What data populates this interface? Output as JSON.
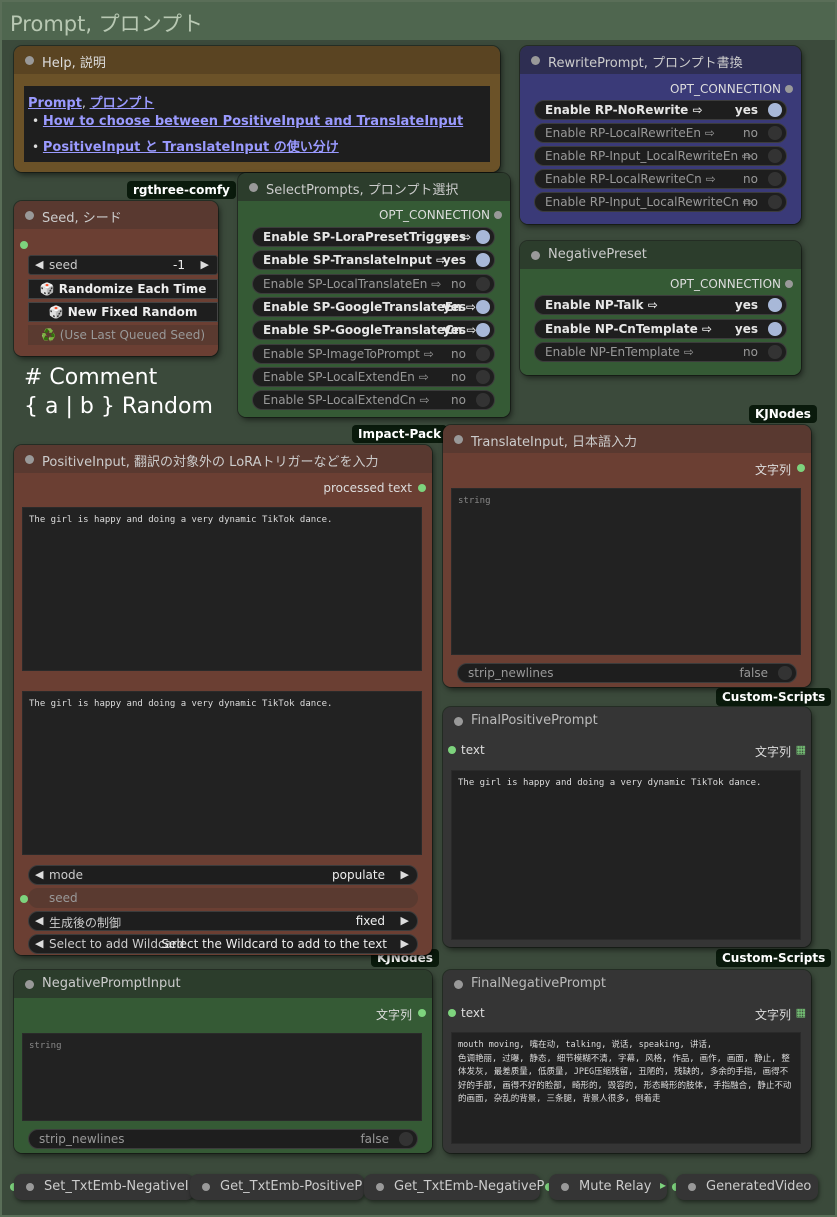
{
  "group": {
    "title": "Prompt, プロンプト"
  },
  "help": {
    "title": "Help, 説明",
    "link_main_a": "Prompt",
    "link_main_sep": ", ",
    "link_main_b": "プロンプト",
    "bullet": "•",
    "link1": "How to choose between PositiveInput and TranslateInput",
    "link2": "PositiveInput と TranslateInput の使い分け"
  },
  "rewrite": {
    "title": "RewritePrompt, プロンプト書換",
    "opt": "OPT_CONNECTION",
    "toggles": [
      {
        "label": "Enable RP-NoRewrite ⇨",
        "value": "yes",
        "on": true
      },
      {
        "label": "Enable RP-LocalRewriteEn ⇨",
        "value": "no",
        "on": false
      },
      {
        "label": "Enable RP-Input_LocalRewriteEn ⇨",
        "value": "no",
        "on": false
      },
      {
        "label": "Enable RP-LocalRewriteCn ⇨",
        "value": "no",
        "on": false
      },
      {
        "label": "Enable RP-Input_LocalRewriteCn ⇨",
        "value": "no",
        "on": false
      }
    ]
  },
  "tags": {
    "rgthree": "rgthree-comfy",
    "impact": "Impact-Pack",
    "kj1": "KJNodes",
    "kj2": "KJNodes",
    "custom1": "Custom-Scripts",
    "custom2": "Custom-Scripts"
  },
  "seed_node": {
    "title": "Seed, シード",
    "seed_label": "seed",
    "seed_value": "-1",
    "btn_random": "🎲 Randomize Each Time",
    "btn_fixed": "🎲 New Fixed Random",
    "btn_last": "♻️ (Use Last Queued Seed)"
  },
  "select": {
    "title": "SelectPrompts, プロンプト選択",
    "opt": "OPT_CONNECTION",
    "toggles": [
      {
        "label": "Enable SP-LoraPresetTrigger ⇨",
        "value": "yes",
        "on": true
      },
      {
        "label": "Enable SP-TranslateInput ⇨",
        "value": "yes",
        "on": true
      },
      {
        "label": "Enable SP-LocalTranslateEn ⇨",
        "value": "no",
        "on": false
      },
      {
        "label": "Enable SP-GoogleTranslateEn ⇨",
        "value": "yes",
        "on": true
      },
      {
        "label": "Enable SP-GoogleTranslateCn ⇨",
        "value": "yes",
        "on": true
      },
      {
        "label": "Enable SP-ImageToPrompt ⇨",
        "value": "no",
        "on": false
      },
      {
        "label": "Enable SP-LocalExtendEn ⇨",
        "value": "no",
        "on": false
      },
      {
        "label": "Enable SP-LocalExtendCn ⇨",
        "value": "no",
        "on": false
      }
    ]
  },
  "comment": {
    "line1": "# Comment",
    "line2": "{ a | b } Random"
  },
  "negative_preset": {
    "title": "NegativePreset",
    "opt": "OPT_CONNECTION",
    "toggles": [
      {
        "label": "Enable NP-Talk ⇨",
        "value": "yes",
        "on": true
      },
      {
        "label": "Enable NP-CnTemplate ⇨",
        "value": "yes",
        "on": true
      },
      {
        "label": "Enable NP-EnTemplate ⇨",
        "value": "no",
        "on": false
      }
    ]
  },
  "positive": {
    "title": "PositiveInput, 翻訳の対象外の LoRAトリガーなどを入力",
    "output": "processed text",
    "text1": "The girl is happy and doing a very dynamic TikTok dance.",
    "text2": "The girl is happy and doing a very dynamic TikTok dance.",
    "mode_label": "mode",
    "mode_value": "populate",
    "seed_label": "seed",
    "control_label": "生成後の制御",
    "control_value": "fixed",
    "wildcard_label": "Select to add Wildcard",
    "wildcard_value": "Select the Wildcard to add to the text"
  },
  "translate": {
    "title": "TranslateInput, 日本語入力",
    "output": "文字列",
    "placeholder": "string",
    "strip_label": "strip_newlines",
    "strip_value": "false"
  },
  "final_positive": {
    "title": "FinalPositivePrompt",
    "input": "text",
    "output": "文字列",
    "text": "The girl is happy and doing a very dynamic TikTok dance."
  },
  "negative_input": {
    "title": "NegativePromptInput",
    "output": "文字列",
    "placeholder": "string",
    "strip_label": "strip_newlines",
    "strip_value": "false"
  },
  "final_negative": {
    "title": "FinalNegativePrompt",
    "input": "text",
    "output": "文字列",
    "text": "mouth moving, 嘴在动, talking, 说话, speaking, 讲话,\n色调艳丽, 过曝, 静态, 细节模糊不清, 字幕, 风格, 作品, 画作, 画面, 静止, 整体发灰, 最差质量, 低质量, JPEG压缩残留, 丑陋的, 残缺的, 多余的手指, 画得不好的手部, 画得不好的脸部, 畸形的, 毁容的, 形态畸形的肢体, 手指融合, 静止不动的画面, 杂乱的背景, 三条腿, 背景人很多, 倒着走"
  },
  "bottom": [
    "Set_TxtEmb-NegativeI",
    "Get_TxtEmb-PositiveP",
    "Get_TxtEmb-NegativeP",
    "Mute Relay",
    "GeneratedVideo"
  ]
}
